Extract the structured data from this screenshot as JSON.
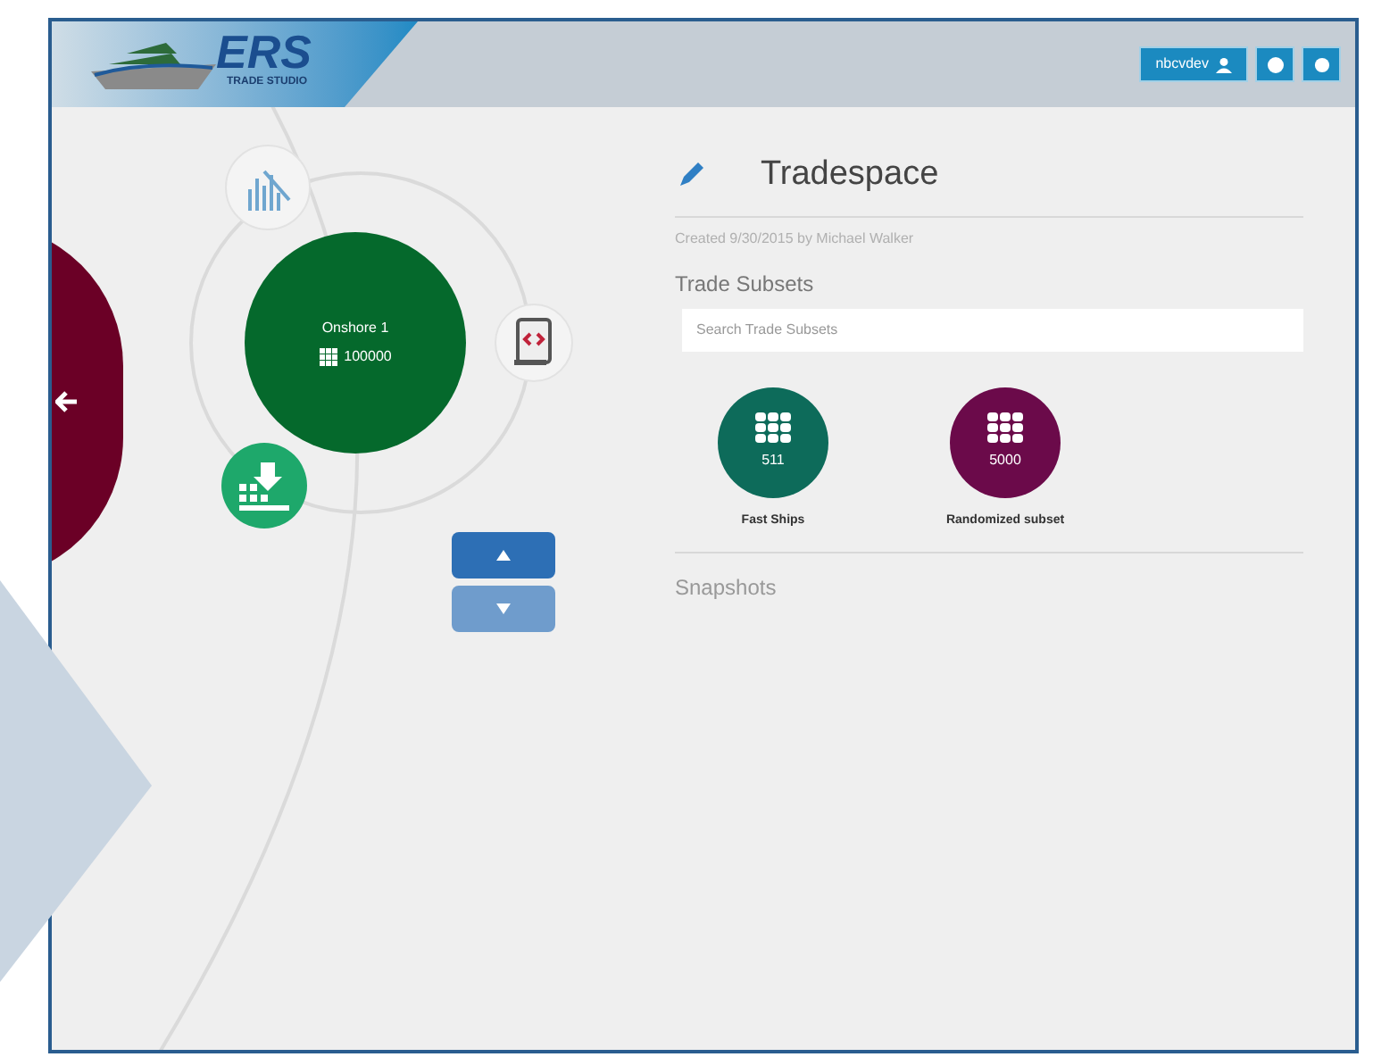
{
  "header": {
    "logo": {
      "title": "ERS",
      "subtitle": "TRADE STUDIO"
    },
    "user_button": "nbcvdev"
  },
  "diagram": {
    "node": {
      "name": "Onshore 1",
      "count": "100000"
    }
  },
  "panel": {
    "title": "Tradespace",
    "created": "Created 9/30/2015 by Michael Walker",
    "subsets_heading": "Trade Subsets",
    "search": {
      "placeholder": "Search Trade Subsets"
    },
    "subsets": [
      {
        "name": "Fast Ships",
        "count": "511",
        "color": "#0d6b5a"
      },
      {
        "name": "Randomized subset",
        "count": "5000",
        "color": "#6b0a4a"
      }
    ],
    "snapshots_heading": "Snapshots"
  }
}
